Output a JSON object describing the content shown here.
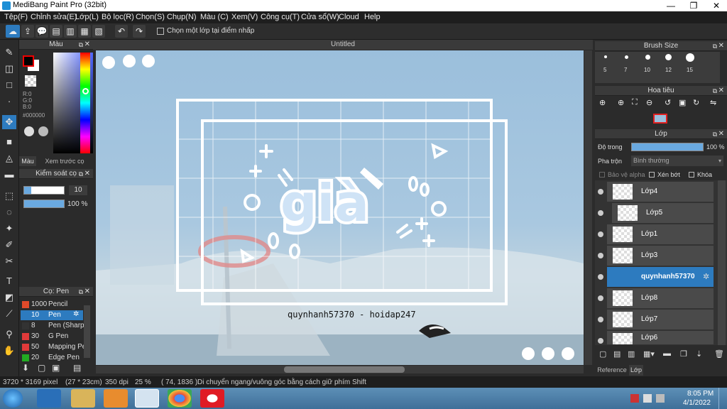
{
  "window": {
    "title": "MediBang Paint Pro (32bit)",
    "min": "—",
    "max": "❐",
    "close": "✕"
  },
  "menu": [
    "Tệp(F)",
    "Chỉnh sửa(E)",
    "Lớp(L)",
    "Bộ lọc(R)",
    "Chọn(S)",
    "Chụp(N)",
    "Màu (C)",
    "Xem(V)",
    "Công cụ(T)",
    "Cửa sổ(W)",
    "Cloud",
    "Help"
  ],
  "toolbar": {
    "checkbox_label": "Chọn một lớp tại điểm nhấp"
  },
  "color_panel": {
    "title": "Màu",
    "r": "R:0",
    "g": "G:0",
    "b": "B:0",
    "hex": "#000000",
    "tab1": "Màu",
    "tab2": "Xem trước cọ"
  },
  "brush_control": {
    "title": "Kiểm soát cọ",
    "size": "10",
    "opacity": "100 %",
    "opacity_level": 1.0
  },
  "pens": {
    "title": "Cọ: Pen",
    "items": [
      {
        "size": "1000",
        "name": "Pencil",
        "color": "#e04a2a"
      },
      {
        "size": "10",
        "name": "Pen",
        "color": "#2d7bbf"
      },
      {
        "size": "8",
        "name": "Pen (Sharp)",
        "color": "#333333"
      },
      {
        "size": "30",
        "name": "G Pen",
        "color": "#e03a3a"
      },
      {
        "size": "50",
        "name": "Mapping Pen",
        "color": "#e03a3a"
      },
      {
        "size": "20",
        "name": "Edge Pen",
        "color": "#22aa22"
      }
    ]
  },
  "canvas": {
    "title": "Untitled",
    "word": "già",
    "caption": "quynhanh57370 - hoidap247"
  },
  "brush_size": {
    "title": "Brush Size",
    "sizes": [
      "5",
      "7",
      "10",
      "12",
      "15"
    ]
  },
  "navigator": {
    "title": "Hoa tiêu"
  },
  "layers": {
    "title": "Lớp",
    "opacity_label": "Độ trong",
    "opacity_value": "100 %",
    "opacity_level": 1.0,
    "blend_label": "Pha trộn",
    "blend_value": "Bình thường",
    "protect_alpha": "Bảo vệ alpha",
    "clipping": "Xén bớt",
    "lock": "Khóa",
    "items": [
      "Lớp4",
      "Lớp5",
      "Lớp1",
      "Lớp3",
      "quynhanh57370",
      "Lớp8",
      "Lớp7",
      "Lớp6"
    ],
    "selected": 4,
    "tab_reference": "Reference",
    "tab_layer": "Lớp"
  },
  "status": {
    "size": "3720 * 3169 pixel",
    "cm": "(27 * 23cm)",
    "dpi": "350 dpi",
    "zoom": "25 %",
    "coords": "( 74, 1836 )",
    "hint": "Di chuyển ngang/vuông góc bằng cách giữ phím Shift"
  },
  "taskbar": {
    "time": "8:05 PM",
    "date": "4/1/2022"
  }
}
